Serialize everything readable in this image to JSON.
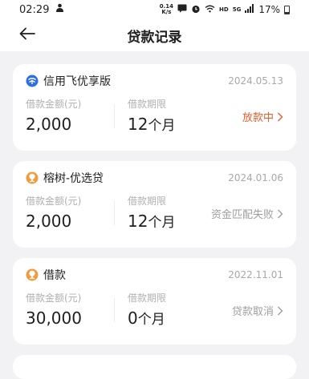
{
  "status_bar": {
    "time": "02:29",
    "net_speed_value": "0.14",
    "net_speed_unit": "K/s",
    "hd_label": "HD",
    "signal_label": "5G",
    "battery": "17%"
  },
  "nav": {
    "title": "贷款记录"
  },
  "loans": [
    {
      "product": "信用飞优享版",
      "icon": "xinyongfei-logo-icon",
      "date": "2024.05.13",
      "amount_label": "借款金额(元)",
      "amount": "2,000",
      "term_label": "借款期限",
      "term_value": "12",
      "term_unit": "个月",
      "status": "放款中"
    },
    {
      "product": "榕树-优选贷",
      "icon": "rongshu-tree-logo-icon",
      "date": "2024.01.06",
      "amount_label": "借款金额(元)",
      "amount": "2,000",
      "term_label": "借款期限",
      "term_value": "12",
      "term_unit": "个月",
      "status": "资金匹配失败"
    },
    {
      "product": "借款",
      "icon": "rongshu-tree-logo-icon",
      "date": "2022.11.01",
      "amount_label": "借款金额(元)",
      "amount": "30,000",
      "term_label": "借款期限",
      "term_value": "0",
      "term_unit": "个月",
      "status": "贷款取消"
    }
  ],
  "colors": {
    "status_active": "#e85d2a",
    "status_muted": "#9e9e9e",
    "page_bg": "#f2f2f4",
    "card_bg": "#ffffff"
  }
}
